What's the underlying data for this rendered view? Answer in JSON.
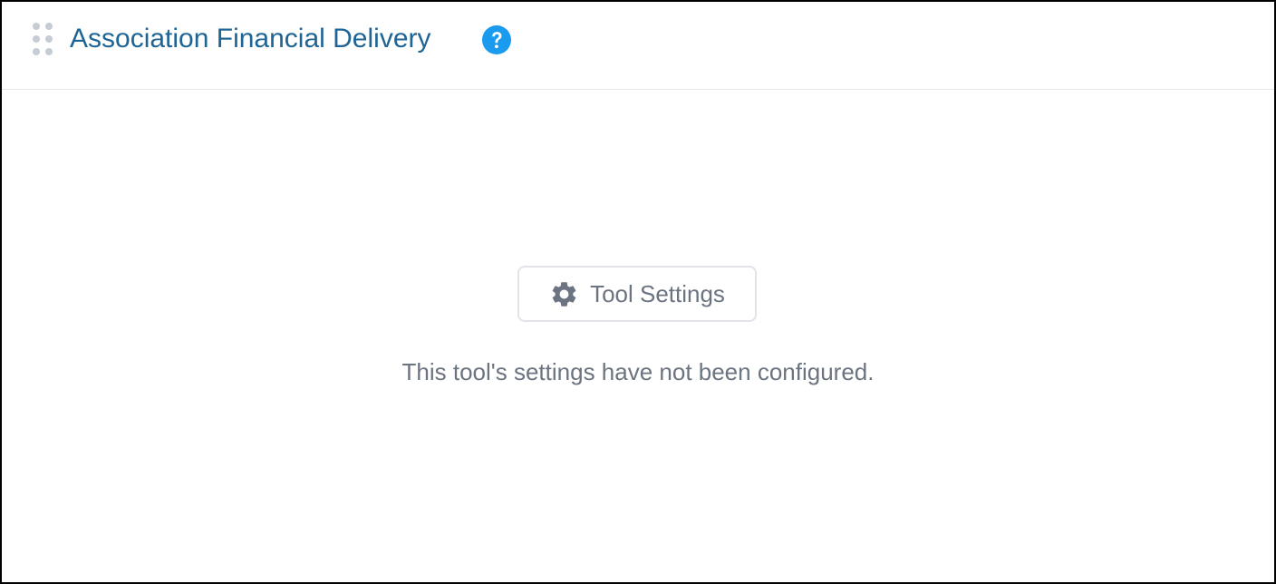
{
  "header": {
    "title": "Association Financial Delivery",
    "help_icon": "question-circle-icon",
    "drag_icon": "drag-handle-icon"
  },
  "content": {
    "settings_button_label": "Tool Settings",
    "settings_icon": "gear-icon",
    "message": "This tool's settings have not been configured."
  },
  "colors": {
    "title": "#1e6495",
    "help_icon_bg": "#1a9bf0",
    "muted_text": "#6b7480",
    "border": "#e1e5e9"
  }
}
